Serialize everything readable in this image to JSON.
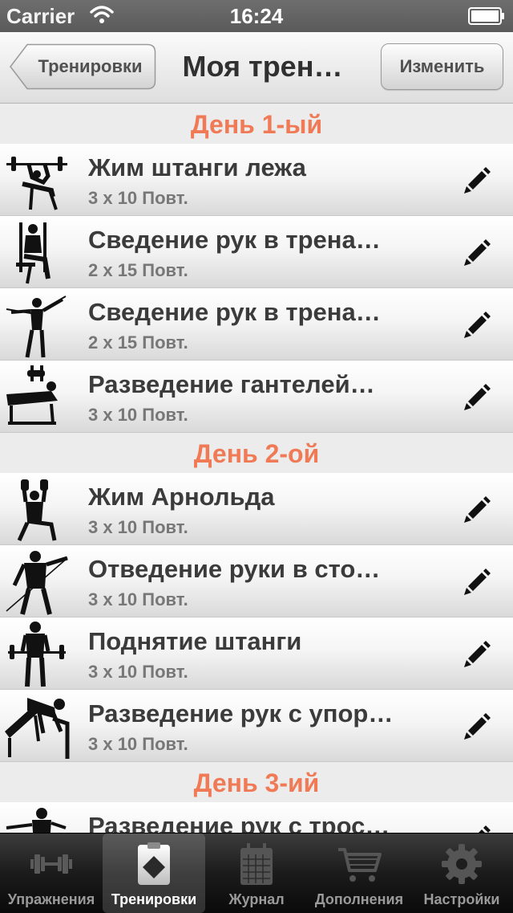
{
  "status": {
    "carrier": "Carrier",
    "time": "16:24"
  },
  "nav": {
    "back_label": "Тренировки",
    "title": "Моя трен…",
    "edit_label": "Изменить"
  },
  "sections": [
    {
      "title": "День 1-ый",
      "items": [
        {
          "name": "Жим штанги лежа",
          "reps": "3 x 10 Повт."
        },
        {
          "name": "Сведение рук в трена…",
          "reps": "2 x 15 Повт."
        },
        {
          "name": "Сведение рук в трена…",
          "reps": "2 x 15 Повт."
        },
        {
          "name": "Разведение гантелей…",
          "reps": "3 x 10 Повт."
        }
      ]
    },
    {
      "title": "День 2-ой",
      "items": [
        {
          "name": "Жим Арнольда",
          "reps": "3 x 10 Повт."
        },
        {
          "name": "Отведение руки в сто…",
          "reps": "3 x 10 Повт."
        },
        {
          "name": "Поднятие штанги",
          "reps": "3 x 10 Повт."
        },
        {
          "name": "Разведение рук с упор…",
          "reps": "3 x 10 Повт."
        }
      ]
    },
    {
      "title": "День 3-ий",
      "items": [
        {
          "name": "Разведение рук с трос…",
          "reps": ""
        }
      ]
    }
  ],
  "tabs": [
    {
      "label": "Упражнения",
      "icon": "dumbbell-icon",
      "active": false
    },
    {
      "label": "Тренировки",
      "icon": "clipboard-icon",
      "active": true
    },
    {
      "label": "Журнал",
      "icon": "calendar-icon",
      "active": false
    },
    {
      "label": "Дополнения",
      "icon": "cart-icon",
      "active": false
    },
    {
      "label": "Настройки",
      "icon": "gear-icon",
      "active": false
    }
  ],
  "colors": {
    "section_header": "#f07a56",
    "tab_active_label": "#ffffff",
    "tab_inactive_label": "#9a9a9a"
  }
}
